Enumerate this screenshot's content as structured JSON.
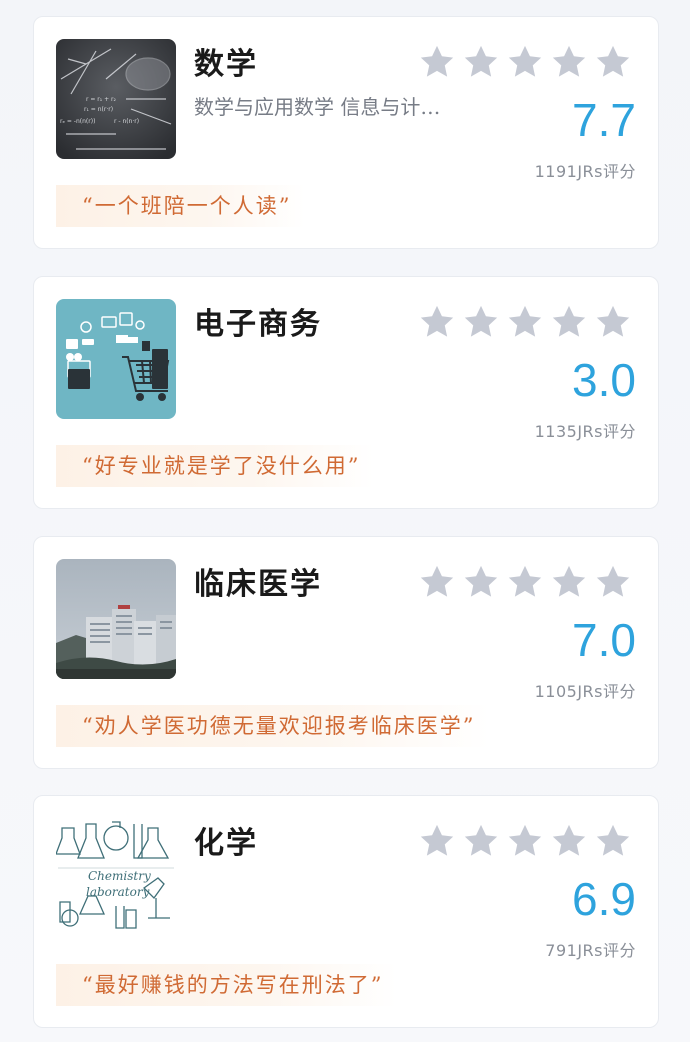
{
  "cards": [
    {
      "title": "数学",
      "subtitle": "数学与应用数学  信息与计…",
      "score": "7.7",
      "count": "1191JRs评分",
      "quote": "“一个班陪一个人读”",
      "thumb_icon": "math-chalkboard-image"
    },
    {
      "title": "电子商务",
      "subtitle": "",
      "score": "3.0",
      "count": "1135JRs评分",
      "quote": "“好专业就是学了没什么用”",
      "thumb_icon": "ecommerce-cart-image"
    },
    {
      "title": "临床医学",
      "subtitle": "",
      "score": "7.0",
      "count": "1105JRs评分",
      "quote": "“劝人学医功德无量欢迎报考临床医学”",
      "thumb_icon": "hospital-building-image"
    },
    {
      "title": "化学",
      "subtitle": "",
      "score": "6.9",
      "count": "791JRs评分",
      "quote": "“最好赚钱的方法写在刑法了”",
      "thumb_icon": "chemistry-laboratory-image",
      "thumb_text_1": "Chemistry",
      "thumb_text_2": "laboratory"
    }
  ],
  "colors": {
    "star": "#c5c9d3",
    "score": "#2ea3dd",
    "quote_text": "#d06a34",
    "quote_bg": "#fdf1e6"
  },
  "star_count": 5
}
